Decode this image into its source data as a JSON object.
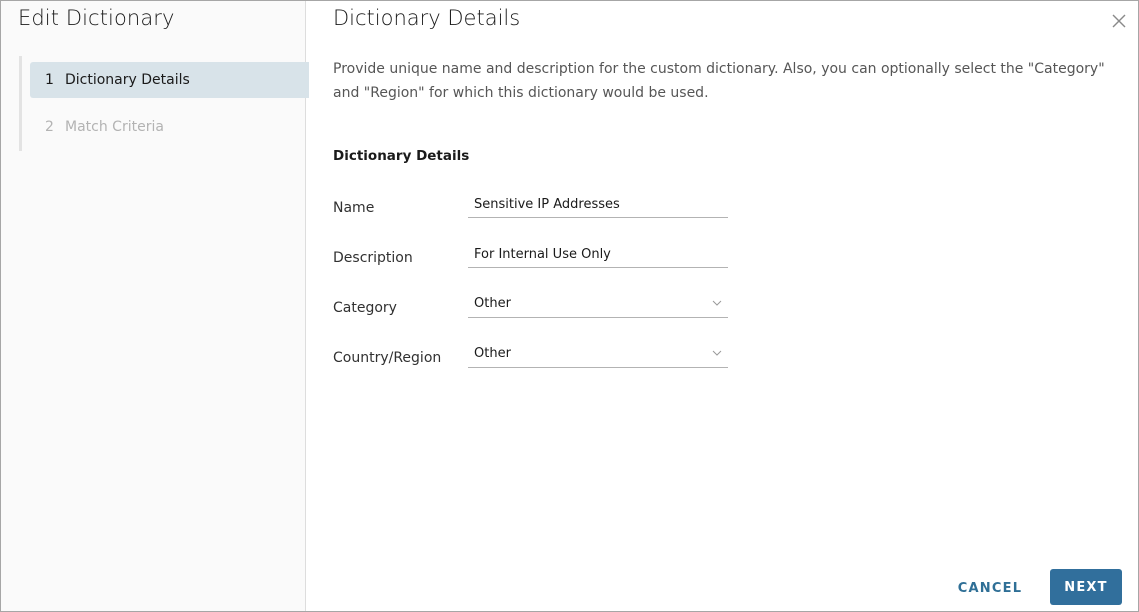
{
  "sidebar": {
    "title": "Edit Dictionary",
    "steps": [
      {
        "number": "1",
        "label": "Dictionary Details",
        "state": "active"
      },
      {
        "number": "2",
        "label": "Match Criteria",
        "state": "disabled"
      }
    ]
  },
  "main": {
    "title": "Dictionary Details",
    "intro": "Provide unique name and description for the custom dictionary. Also, you can optionally select the \"Category\" and \"Region\" for which this dictionary would be used.",
    "section_title": "Dictionary Details",
    "fields": {
      "name": {
        "label": "Name",
        "value": "Sensitive IP Addresses"
      },
      "description": {
        "label": "Description",
        "value": "For Internal Use Only"
      },
      "category": {
        "label": "Category",
        "value": "Other"
      },
      "region": {
        "label": "Country/Region",
        "value": "Other"
      }
    }
  },
  "footer": {
    "cancel_label": "CANCEL",
    "next_label": "NEXT"
  },
  "icons": {
    "close": "close-icon",
    "dropdown": "chevron-down-icon"
  },
  "colors": {
    "primary": "#316f9c",
    "active_step_bg": "#d8e3e9",
    "link": "#2f6f96"
  }
}
